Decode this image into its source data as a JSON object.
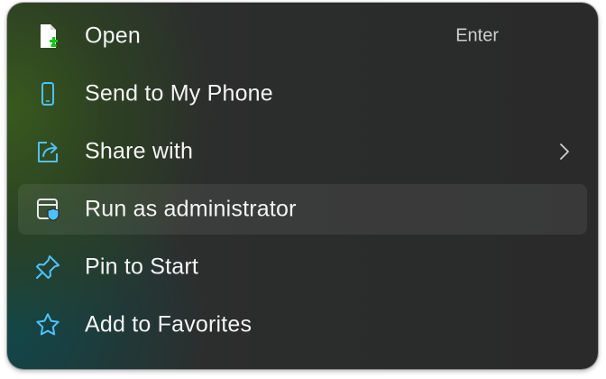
{
  "menu": {
    "items": [
      {
        "label": "Open",
        "shortcut": "Enter",
        "icon": "document-open-icon"
      },
      {
        "label": "Send to My Phone",
        "icon": "phone-icon"
      },
      {
        "label": "Share with",
        "icon": "share-icon",
        "submenu": true
      },
      {
        "label": "Run as administrator",
        "icon": "admin-shield-icon",
        "highlighted": true
      },
      {
        "label": "Pin to Start",
        "icon": "pin-icon"
      },
      {
        "label": "Add to Favorites",
        "icon": "star-icon"
      }
    ]
  },
  "colors": {
    "accent": "#4cc2ff",
    "green_accent": "#16c60c",
    "menu_background": "#2b2b2b",
    "hover_background": "#3a3a3a"
  }
}
